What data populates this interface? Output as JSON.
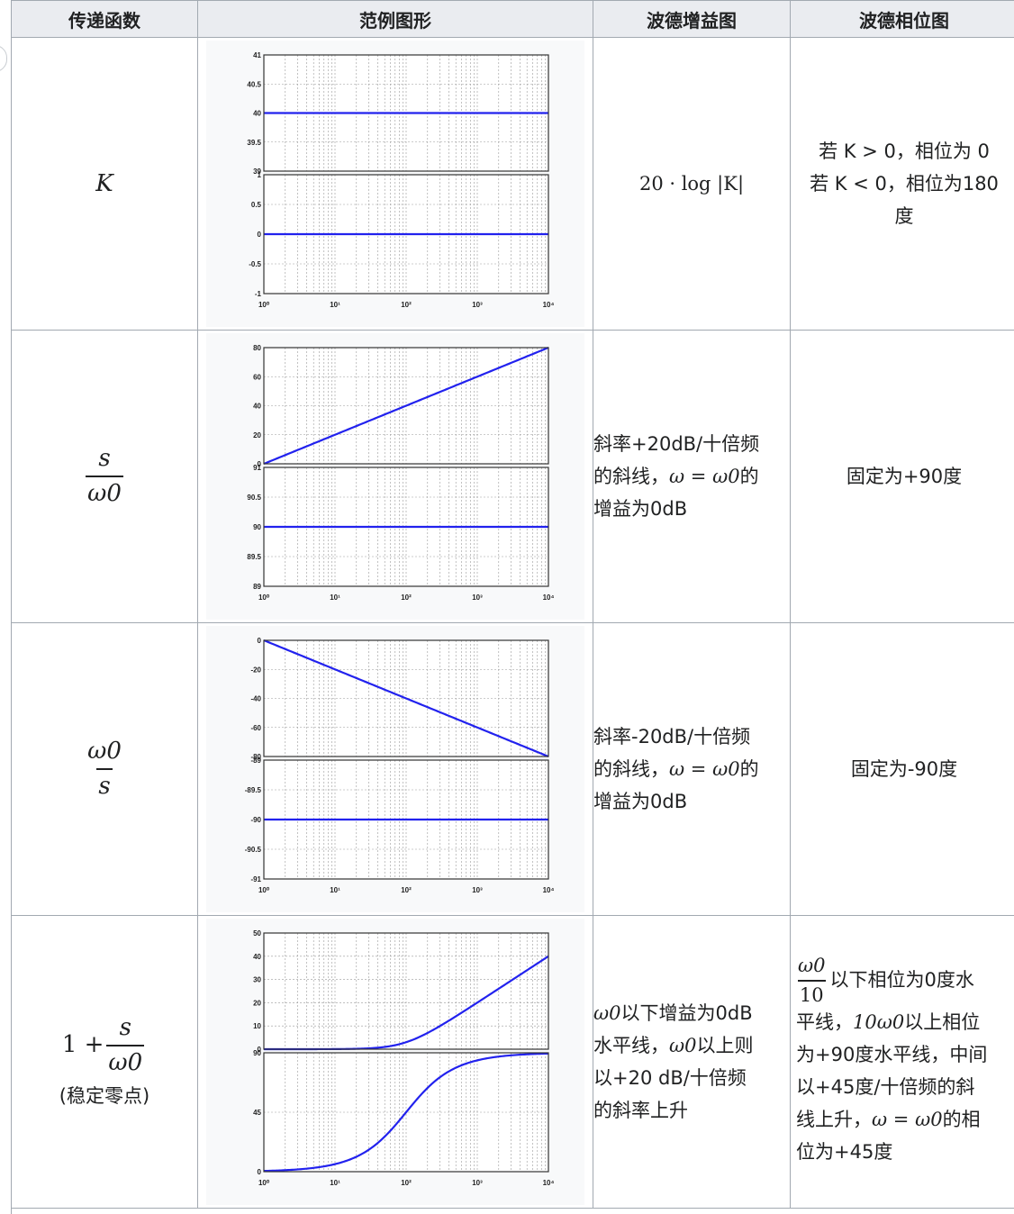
{
  "headers": [
    "传递函数",
    "范例图形",
    "波德增益图",
    "波德相位图"
  ],
  "colors": {
    "line": "#2222ee",
    "border": "#a2a9b1",
    "header_bg": "#eaecf0"
  },
  "rows": [
    {
      "transfer": {
        "type": "symbol",
        "symbol": "K"
      },
      "gain_text": {
        "lines": [
          "20 · log |K|"
        ]
      },
      "phase_text": [
        "若 K > 0，相位为 0",
        "若 K < 0，相位为180",
        "度"
      ]
    },
    {
      "transfer": {
        "type": "fraction",
        "num": "s",
        "den": "ω0"
      },
      "gain_text": {
        "line1": "斜率+20dB/十倍频",
        "line2_prefix": "的斜线，",
        "line2_math": "ω = ω0",
        "line2_suffix": "的",
        "line3": "增益为0dB"
      },
      "phase_text": [
        "固定为+90度"
      ]
    },
    {
      "transfer": {
        "type": "fraction",
        "num": "ω0",
        "den": "s"
      },
      "gain_text": {
        "line1": "斜率-20dB/十倍频",
        "line2_prefix": "的斜线，",
        "line2_math": "ω = ω0",
        "line2_suffix": "的",
        "line3": "增益为0dB"
      },
      "phase_text": [
        "固定为-90度"
      ]
    },
    {
      "transfer": {
        "type": "sum",
        "lead": "1 +",
        "num": "s",
        "den": "ω0",
        "note": "(稳定零点)"
      },
      "gain_text": {
        "l1_math": "ω0",
        "l1_text": "以下增益为0dB",
        "l2_text_a": "水平线，",
        "l2_math": "ω0",
        "l2_text_b": "以上则",
        "l3": "以+20 dB/十倍频",
        "l4": "的斜率上升"
      },
      "phase_text": {
        "frac_num": "ω0",
        "frac_den": "10",
        "l1_text": "以下相位为0度水",
        "l2_text_a": "平线，",
        "l2_math": "10ω0",
        "l2_text_b": "以上相位",
        "l3": "为+90度水平线，中间",
        "l4": "以+45度/十倍频的斜",
        "l5_text_a": "线上升，",
        "l5_math": "ω = ω0",
        "l5_text_b": "的相",
        "l6": "位为+45度"
      }
    }
  ],
  "chart_data": [
    {
      "type": "line",
      "x_scale": "log",
      "xlim": [
        1,
        10000
      ],
      "x_ticks": [
        "10⁰",
        "10¹",
        "10²",
        "10³",
        "10⁴"
      ],
      "grid": true,
      "panels": [
        {
          "ylim": [
            39,
            41
          ],
          "y_ticks": [
            "41",
            "40.5",
            "40",
            "39.5",
            "39"
          ],
          "curve": "constant",
          "value": 40
        },
        {
          "ylim": [
            -1,
            1
          ],
          "y_ticks": [
            "1",
            "0.5",
            "0",
            "-0.5",
            "-1"
          ],
          "curve": "constant",
          "value": 0
        }
      ]
    },
    {
      "type": "line",
      "x_scale": "log",
      "xlim": [
        1,
        10000
      ],
      "x_ticks": [
        "10⁰",
        "10¹",
        "10²",
        "10³",
        "10⁴"
      ],
      "grid": true,
      "panels": [
        {
          "ylim": [
            0,
            80
          ],
          "y_ticks": [
            "80",
            "60",
            "40",
            "20",
            "0"
          ],
          "curve": "linear",
          "from": 0,
          "to": 80
        },
        {
          "ylim": [
            89,
            91
          ],
          "y_ticks": [
            "91",
            "90.5",
            "90",
            "89.5",
            "89"
          ],
          "curve": "constant",
          "value": 90
        }
      ]
    },
    {
      "type": "line",
      "x_scale": "log",
      "xlim": [
        1,
        10000
      ],
      "x_ticks": [
        "10⁰",
        "10¹",
        "10²",
        "10³",
        "10⁴"
      ],
      "grid": true,
      "panels": [
        {
          "ylim": [
            -80,
            0
          ],
          "y_ticks": [
            "0",
            "-20",
            "-40",
            "-60",
            "-80"
          ],
          "curve": "linear",
          "from": 0,
          "to": -80
        },
        {
          "ylim": [
            -91,
            -89
          ],
          "y_ticks": [
            "-89",
            "-89.5",
            "-90",
            "-90.5",
            "-91"
          ],
          "curve": "constant",
          "value": -90
        }
      ]
    },
    {
      "type": "line",
      "x_scale": "log",
      "xlim": [
        1,
        10000
      ],
      "x_ticks": [
        "10⁰",
        "10¹",
        "10²",
        "10³",
        "10⁴"
      ],
      "grid": true,
      "panels": [
        {
          "ylim": [
            0,
            50
          ],
          "y_ticks": [
            "50",
            "40",
            "30",
            "20",
            "10",
            "0"
          ],
          "curve": "zero_mag",
          "w0": 100
        },
        {
          "ylim": [
            0,
            90
          ],
          "y_ticks": [
            "90",
            "45",
            "0"
          ],
          "curve": "zero_phase",
          "w0": 100
        }
      ]
    }
  ]
}
